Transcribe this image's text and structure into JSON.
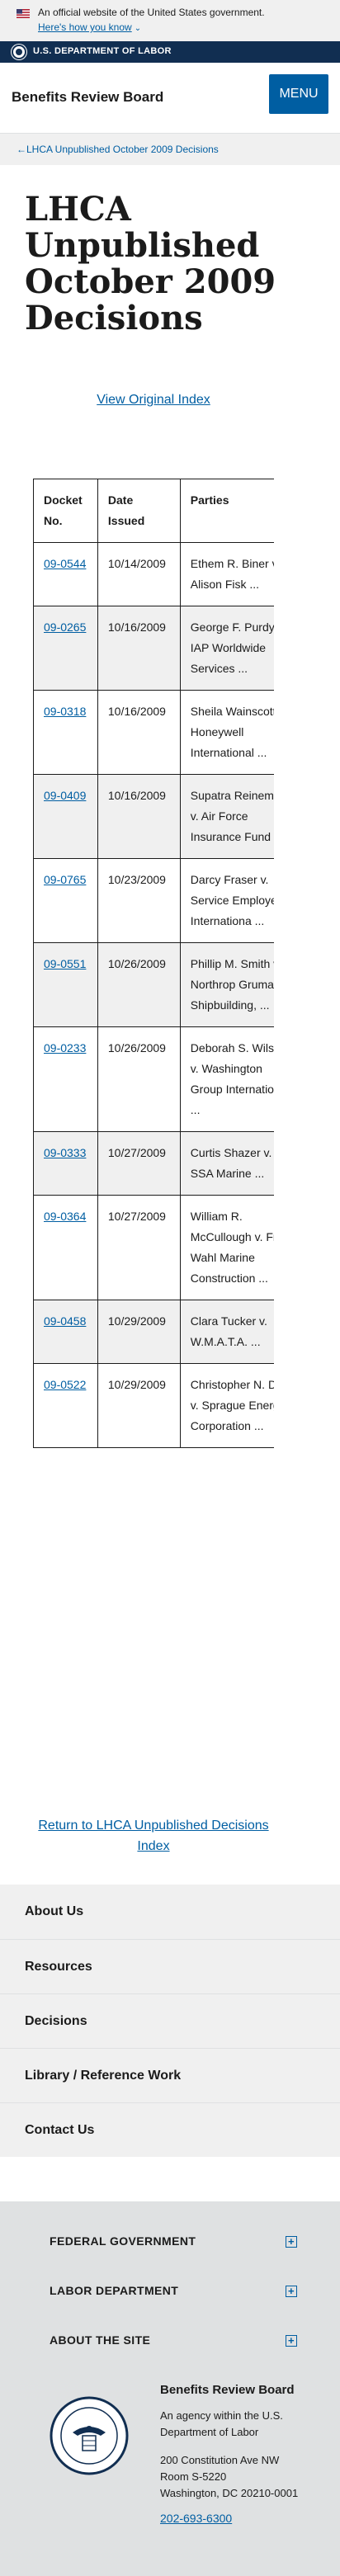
{
  "banner": {
    "official_text": "An official website of the United States government.",
    "how_know_text": "Here's how you know"
  },
  "dol_bar": {
    "name": "U.S. DEPARTMENT OF LABOR"
  },
  "header": {
    "site_title": "Benefits Review Board",
    "menu_label": "MENU"
  },
  "breadcrumb": {
    "label": "LHCA Unpublished October 2009 Decisions"
  },
  "page": {
    "title": "LHCA Unpublished October 2009 Decisions",
    "view_original_link": "View Original Index",
    "return_link": "Return to LHCA Unpublished Decisions Index"
  },
  "table": {
    "headers": {
      "docket": "Docket No.",
      "date": "Date Issued",
      "parties": "Parties"
    },
    "rows": [
      {
        "docket": "09-0544",
        "date": "10/14/2009",
        "parties": "Ethem R. Biner v. Alison Fisk ..."
      },
      {
        "docket": "09-0265",
        "date": "10/16/2009",
        "parties": "George F. Purdy v. IAP Worldwide Services ..."
      },
      {
        "docket": "09-0318",
        "date": "10/16/2009",
        "parties": "Sheila Wainscott v. Honeywell International ..."
      },
      {
        "docket": "09-0409",
        "date": "10/16/2009",
        "parties": "Supatra Reinemann v. Air Force Insurance Fund ..."
      },
      {
        "docket": "09-0765",
        "date": "10/23/2009",
        "parties": "Darcy Fraser v. Service Employees Internationa ..."
      },
      {
        "docket": "09-0551",
        "date": "10/26/2009",
        "parties": "Phillip M. Smith v. Northrop Gruman Shipbuilding, ..."
      },
      {
        "docket": "09-0233",
        "date": "10/26/2009",
        "parties": "Deborah S. Wilson v. Washington Group International ..."
      },
      {
        "docket": "09-0333",
        "date": "10/27/2009",
        "parties": "Curtis Shazer v. SSA Marine ..."
      },
      {
        "docket": "09-0364",
        "date": "10/27/2009",
        "parties": "William R. McCullough v. Fred Wahl Marine Construction ..."
      },
      {
        "docket": "09-0458",
        "date": "10/29/2009",
        "parties": "Clara Tucker v. W.M.A.T.A. ..."
      },
      {
        "docket": "09-0522",
        "date": "10/29/2009",
        "parties": "Christopher N. Dean v. Sprague Energy Corporation ..."
      }
    ]
  },
  "footer_nav": [
    "About Us",
    "Resources",
    "Decisions",
    "Library / Reference Work",
    "Contact Us"
  ],
  "footer_sections": [
    "FEDERAL GOVERNMENT",
    "LABOR DEPARTMENT",
    "ABOUT THE SITE"
  ],
  "footer_agency": {
    "name": "Benefits Review Board",
    "desc_line1": "An agency within the U.S.",
    "desc_line2": "Department of Labor",
    "addr1": "200 Constitution Ave NW",
    "addr2": "Room S-5220",
    "addr3": "Washington, DC 20210-0001",
    "phone": "202-693-6300",
    "seal_text": "DEPARTMENT OF LABOR"
  },
  "colors": {
    "link": "#005ea2",
    "navy": "#112e51",
    "light_gray": "#f0f0f0",
    "footer_gray": "#dfe1e2"
  }
}
